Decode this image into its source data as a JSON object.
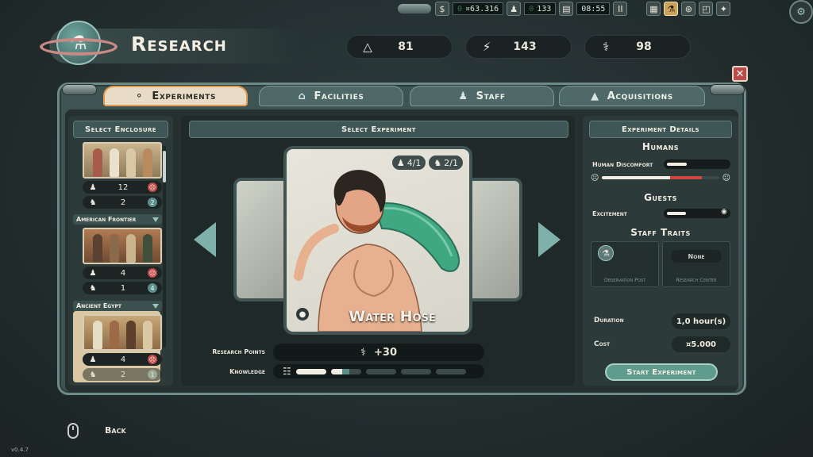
{
  "topbar": {
    "money": "¤63.316",
    "money_dim": "0",
    "people": "133",
    "people_dim": "0",
    "clock": "08:55",
    "pause": "II"
  },
  "header": {
    "title": "Research"
  },
  "stats": [
    {
      "icon": "flask-icon",
      "value": "81"
    },
    {
      "icon": "lightning-icon",
      "value": "143"
    },
    {
      "icon": "research-flask-icon",
      "value": "98"
    }
  ],
  "tabs": [
    {
      "label": "Experiments",
      "active": true
    },
    {
      "label": "Facilities",
      "active": false
    },
    {
      "label": "Staff",
      "active": false
    },
    {
      "label": "Acquisitions",
      "active": false
    }
  ],
  "enclosures": {
    "header": "Select Enclosure",
    "items": [
      {
        "label": "",
        "humans": "12",
        "staff": "2",
        "staff_badge": "2"
      },
      {
        "label": "American Frontier",
        "humans": "4",
        "staff": "1",
        "staff_badge": "4"
      },
      {
        "label": "Ancient Egypt",
        "humans": "4",
        "staff": "2",
        "staff_badge": "1"
      }
    ]
  },
  "experiment": {
    "header": "Select Experiment",
    "name": "Water Hose",
    "req_humans": "4/1",
    "req_staff": "2/1",
    "research_points_label": "Research Points",
    "research_points": "+30",
    "knowledge_label": "Knowledge",
    "knowledge_progress": [
      1,
      0.6,
      0,
      0,
      0
    ]
  },
  "details": {
    "header": "Experiment Details",
    "humans_title": "Humans",
    "human_discomfort_label": "Human Discomfort",
    "human_discomfort_level": 0.3,
    "guests_title": "Guests",
    "excitement_label": "Excitement",
    "excitement_level": 0.28,
    "staff_traits_title": "Staff Traits",
    "trait1_label": "Observation Post",
    "trait2_value": "None",
    "trait2_label": "Research Center",
    "duration_label": "Duration",
    "duration_value": "1,0 hour(s)",
    "cost_label": "Cost",
    "cost_value": "¤5.000",
    "start_button": "Start Experiment"
  },
  "footer": {
    "back": "Back",
    "version": "v0.4.7"
  },
  "colors": {
    "accent_orange": "#e29c52",
    "panel_teal": "#4f6968",
    "discomfort_red": "#d2463f"
  }
}
